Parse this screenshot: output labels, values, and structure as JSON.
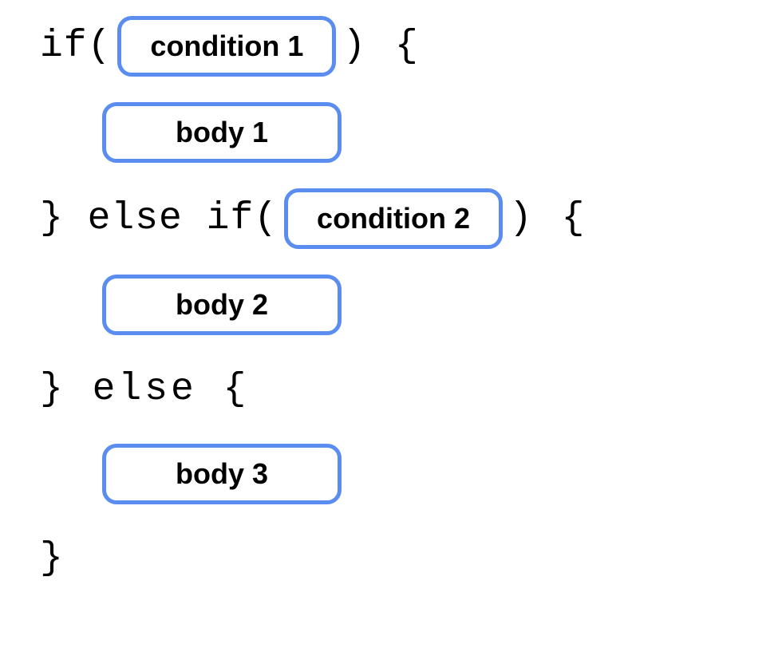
{
  "diagram": {
    "line1": {
      "prefix": "if(",
      "condition": "condition 1",
      "suffix": ") {"
    },
    "body1": "body 1",
    "line3": {
      "prefix": "} else if(",
      "condition": "condition 2",
      "suffix": ") {"
    },
    "body2": "body 2",
    "line5": "} else {",
    "body3": "body 3",
    "line7": "}"
  }
}
